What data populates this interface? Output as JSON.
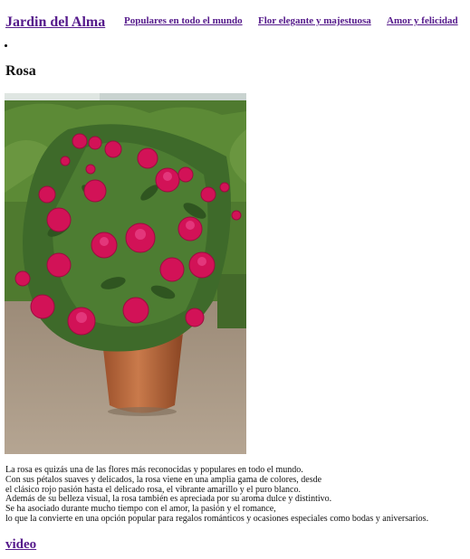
{
  "nav": {
    "brand": "Jardin del Alma",
    "links": [
      "Populares en todo el mundo",
      "Flor elegante y majestuosa",
      "Amor y felicidad"
    ]
  },
  "page": {
    "title": "Rosa",
    "paragraph": [
      "La rosa es quizás una de las flores más reconocidas y populares en todo el mundo.",
      "Con sus pétalos suaves y delicados, la rosa viene en una amplia gama de colores, desde",
      "el clásico rojo pasión hasta el delicado rosa, el vibrante amarillo y el puro blanco.",
      "Además de su belleza visual, la rosa también es apreciada por su aroma dulce y distintivo.",
      "Se ha asociado durante mucho tiempo con el amor, la pasión y el romance,",
      "lo que la convierte en una opción popular para regalos románticos y ocasiones especiales como bodas y aniversarios."
    ],
    "video_link": "video"
  },
  "colors": {
    "link": "#551a8b",
    "rose": "#d21257",
    "foliage": "#3e6a2a",
    "pot": "#bd6a3e",
    "gravel": "#a89784"
  }
}
